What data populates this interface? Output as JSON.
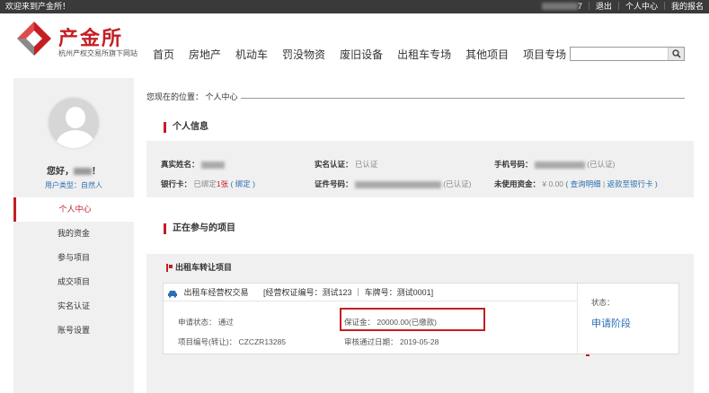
{
  "topbar": {
    "welcome": "欢迎来到产金所！",
    "user_suffix": "7",
    "logout": "退出",
    "center": "个人中心",
    "signup": "我的报名"
  },
  "brand": {
    "name": "产金所",
    "tagline": "杭州产权交易所旗下网站",
    "color": "#c41e24"
  },
  "nav": [
    "首页",
    "房地产",
    "机动车",
    "罚没物资",
    "废旧设备",
    "出租车专场",
    "其他项目",
    "项目专场"
  ],
  "search": {
    "placeholder": "",
    "icon": "search-icon"
  },
  "sidebar": {
    "hello_prefix": "您好，",
    "hello_suffix": "！",
    "user_type_label": "用户类型：",
    "user_type": "自然人",
    "menu": [
      "个人中心",
      "我的资金",
      "参与项目",
      "成交项目",
      "实名认证",
      "账号设置"
    ],
    "active_index": 0
  },
  "breadcrumb": "您现在的位置： 个人中心",
  "personal": {
    "title": "个人信息",
    "real_name_label": "真实姓名：",
    "realname_verify_label": "实名认证：",
    "realname_verify_value": "已认证",
    "phone_label": "手机号码：",
    "phone_status": "(已认证)",
    "bank_label": "银行卡：",
    "bank_value_prefix": "已绑定",
    "bank_count": "1张",
    "bank_link": "( 绑定 )",
    "id_label": "证件号码：",
    "id_status": "(已认证)",
    "funds_label": "未使用资金：",
    "funds_value": "¥ 0.00",
    "funds_link1": "( 查询明细",
    "funds_sep": " | ",
    "funds_link2": "返款至银行卡 )"
  },
  "projects": {
    "title": "正在参与的项目",
    "group_title": "出租车转让项目",
    "item": {
      "name": "出租车经营权交易",
      "code": "[经营权证编号：测试123 ｜ 车牌号：测试0001]",
      "apply_status": "申请状态： 通过",
      "deposit": "保证金： 20000.00(已缴款)",
      "project_no": "项目编号(转让)： CZCZR13285",
      "approve_date": "审核通过日期： 2019-05-28",
      "state_label": "状态：",
      "state_value": "申请阶段"
    }
  }
}
